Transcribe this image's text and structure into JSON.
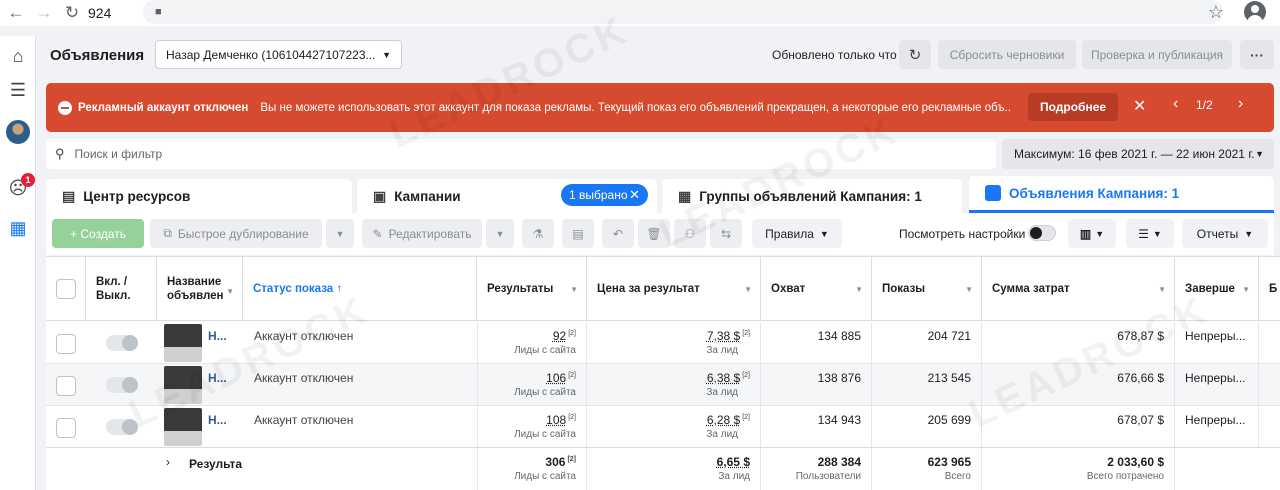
{
  "browser": {
    "url": "924",
    "back_icon": "arrow-left-icon",
    "forward_icon": "arrow-right-icon",
    "reload_icon": "reload-icon"
  },
  "header": {
    "title": "Объявления",
    "account": "Назар Демченко (106104427107223...",
    "updated": "Обновлено только что",
    "discard_label": "Сбросить черновики",
    "review_label": "Проверка и публикация",
    "more_label": "···"
  },
  "sidebar": {
    "badge": "1"
  },
  "alert": {
    "title": "Рекламный аккаунт отключен",
    "text": "Вы не можете использовать этот аккаунт для показа рекламы. Текущий показ его объявлений прекращен, а некоторые его рекламные объ...",
    "more_label": "Подробнее",
    "page": "1/2",
    "color": "#d64a2f"
  },
  "search": {
    "placeholder": "Поиск и фильтр"
  },
  "date_range": "Максимум: 16 фев 2021 г. — 22 июн 2021 г.",
  "tabs": [
    {
      "label": "Центр ресурсов"
    },
    {
      "label": "Кампании"
    },
    {
      "label": "Группы объявлений Кампания: 1"
    },
    {
      "label": "Объявления Кампания: 1"
    }
  ],
  "selected_pill": "1 выбрано",
  "toolbar": {
    "create_label": "+ Создать",
    "duplicate_label": "Быстрое дублирование",
    "edit_label": "Редактировать",
    "rules_label": "Правила",
    "view_settings_label": "Посмотреть настройки",
    "reports_label": "Отчеты"
  },
  "table": {
    "columns": [
      "Вкл. / Выкл.",
      "Название объявлен",
      "Статус показа ↑",
      "Результаты",
      "Цена за результат",
      "Охват",
      "Показы",
      "Сумма затрат",
      "Заверше",
      "Б"
    ],
    "rows": [
      {
        "name": "Н...",
        "status": "Аккаунт отключен",
        "results": "92",
        "results_sub": "Лиды с сайта",
        "cpr": "7,38 $",
        "cpr_sub": "За лид",
        "reach": "134 885",
        "impressions": "204 721",
        "spend": "678,87 $",
        "end": "Непреры..."
      },
      {
        "name": "Н...",
        "status": "Аккаунт отключен",
        "results": "106",
        "results_sub": "Лиды с сайта",
        "cpr": "6,38 $",
        "cpr_sub": "За лид",
        "reach": "138 876",
        "impressions": "213 545",
        "spend": "676,66 $",
        "end": "Непреры..."
      },
      {
        "name": "Н...",
        "status": "Аккаунт отключен",
        "results": "108",
        "results_sub": "Лиды с сайта",
        "cpr": "6,28 $",
        "cpr_sub": "За лид",
        "reach": "134 943",
        "impressions": "205 699",
        "spend": "678,07 $",
        "end": "Непреры..."
      }
    ],
    "totals": {
      "label": "Результа",
      "results": "306",
      "results_sub": "Лиды с сайта",
      "cpr": "6,65 $",
      "cpr_sub": "За лид",
      "reach": "288 384",
      "reach_sub": "Пользователи",
      "impressions": "623 965",
      "impressions_sub": "Всего",
      "spend": "2 033,60 $",
      "spend_sub": "Всего потрачено"
    },
    "footnote_mark": "[2]"
  },
  "watermark": "LEADROCK",
  "colors": {
    "accent": "#1877f2",
    "create": "#97d19a",
    "link": "#385898"
  }
}
